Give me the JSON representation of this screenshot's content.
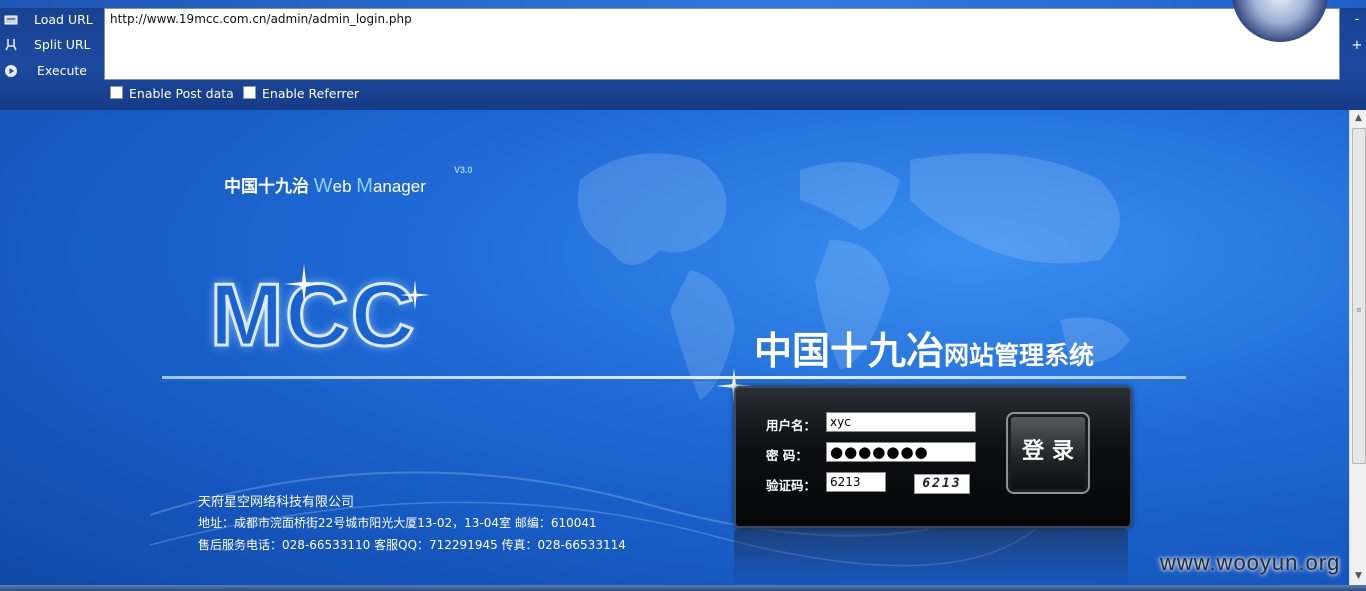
{
  "hackbar": {
    "menu": [
      {
        "label": "Load URL",
        "icon": "load-url-icon"
      },
      {
        "label": "Split URL",
        "icon": "split-url-icon"
      },
      {
        "label": "Execute",
        "icon": "execute-icon"
      }
    ],
    "url_value": "http://www.19mcc.com.cn/admin/admin_login.php",
    "options": [
      "Enable Post data",
      "Enable Referrer"
    ],
    "side_controls": [
      "-",
      "+"
    ]
  },
  "page": {
    "brand_cn": "中国十九治",
    "brand_w": "W",
    "brand_eb": "eb ",
    "brand_m": "M",
    "brand_anager": "anager",
    "version": "V3.0",
    "logo_text": "MCC",
    "system_title_big": "中国十九冶",
    "system_title_small": "网站管理系统",
    "login": {
      "username_label": "用户名：",
      "username_value": "xyc",
      "password_label": "密  码：",
      "password_value": "●●●●●●●",
      "captcha_label": "验证码：",
      "captcha_value": "6213",
      "captcha_image_text": "6213",
      "submit_label": "登 录"
    },
    "company_name": "天府星空网络科技有限公司",
    "address": "地址：成都市浣面桥街22号城市阳光大厦13-02，13-04室 邮编：610041",
    "contact": "售后服务电话：028-66533110 客服QQ：712291945 传真：028-66533114"
  },
  "watermark": "www.wooyun.org",
  "colors": {
    "accent": "#1d5fc6",
    "hackbar": "#1c4aa0",
    "login_bg": "#0d1014"
  }
}
